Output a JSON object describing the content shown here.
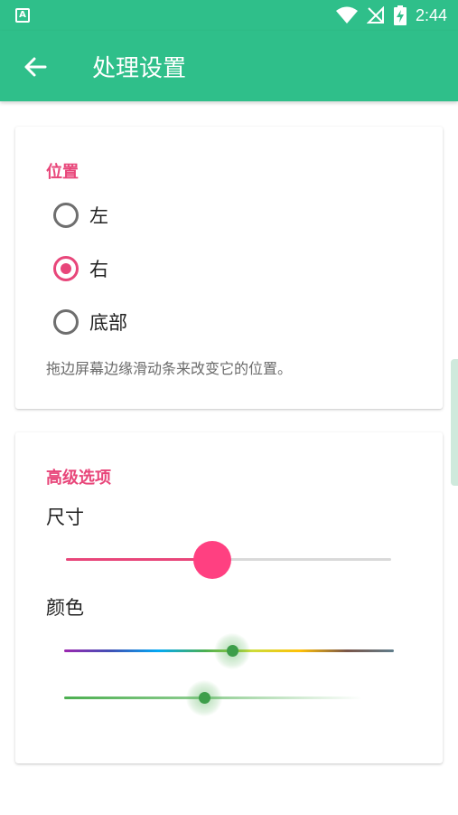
{
  "status_bar": {
    "time": "2:44",
    "app_icon": "A"
  },
  "app_bar": {
    "title": "处理设置"
  },
  "position_section": {
    "title": "位置",
    "options": [
      {
        "label": "左",
        "checked": false
      },
      {
        "label": "右",
        "checked": true
      },
      {
        "label": "底部",
        "checked": false
      }
    ],
    "hint": "拖边屏幕边缘滑动条来改变它的位置。"
  },
  "advanced_section": {
    "title": "高级选项",
    "size_label": "尺寸",
    "size_value": 0.45,
    "color_label": "颜色",
    "hue_value": 0.51,
    "opacity_value": 0.47
  },
  "colors": {
    "primary": "#2fbf8a",
    "accent": "#e8467a",
    "slider_green": "#4caf50"
  }
}
